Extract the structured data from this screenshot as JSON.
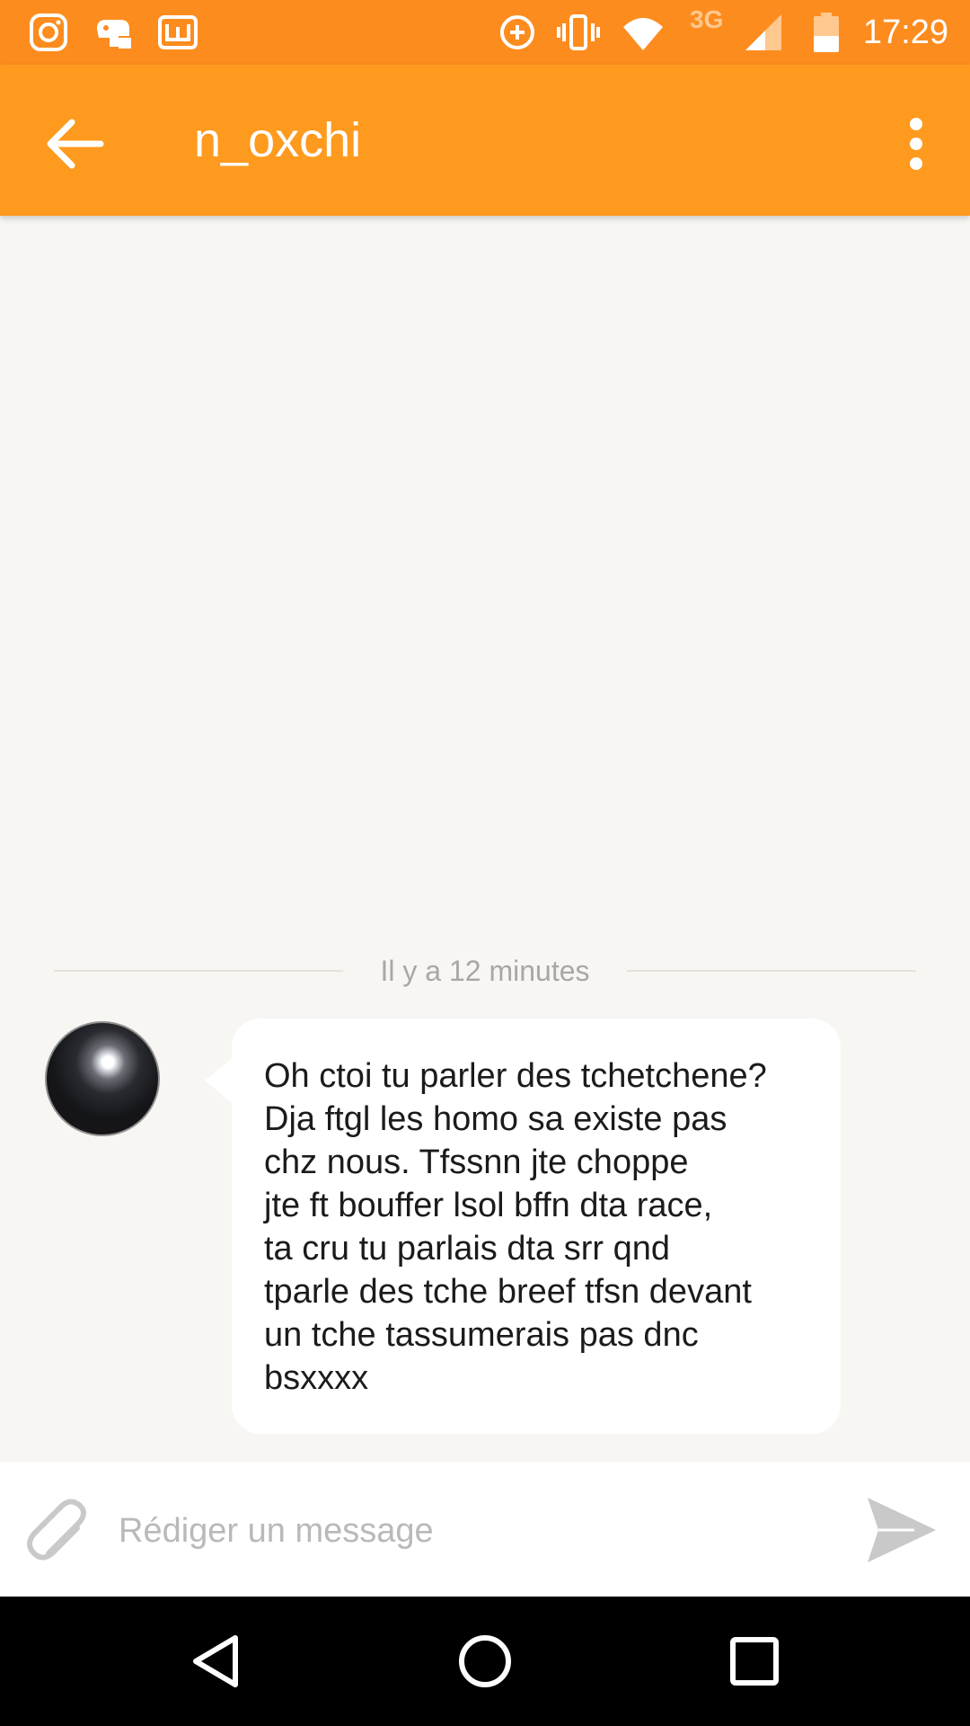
{
  "status_bar": {
    "time": "17:29",
    "network": "3G",
    "icons": [
      "instagram-icon",
      "game-icon",
      "webtoon-icon",
      "data-saver-icon",
      "vibrate-icon",
      "wifi-icon",
      "signal-icon",
      "battery-icon"
    ]
  },
  "app_bar": {
    "title": "n_oxchi",
    "back_icon": "arrow-back-icon",
    "menu_icon": "more-vert-icon"
  },
  "conversation": {
    "time_divider": "Il y a 12 minutes",
    "messages": [
      {
        "sender": "n_oxchi",
        "text": "Oh ctoi tu parler des tchetchene?\nDja ftgl les homo sa existe pas\nchz nous. Tfssnn jte choppe\njte ft bouffer lsol bffn dta race,\nta cru tu parlais dta srr qnd\ntparle des tche breef tfsn devant\nun tche tassumerais pas dnc\nbsxxxx"
      }
    ]
  },
  "composer": {
    "placeholder": "Rédiger un message",
    "value": "",
    "attach_icon": "paperclip-icon",
    "send_icon": "send-icon"
  },
  "nav_bar": {
    "buttons": [
      "back-triangle-icon",
      "home-circle-icon",
      "recents-square-icon"
    ]
  },
  "colors": {
    "status_bar": "#fd8c1e",
    "app_bar": "#fe9a1e",
    "background": "#f7f6f3",
    "bubble": "#ffffff"
  }
}
